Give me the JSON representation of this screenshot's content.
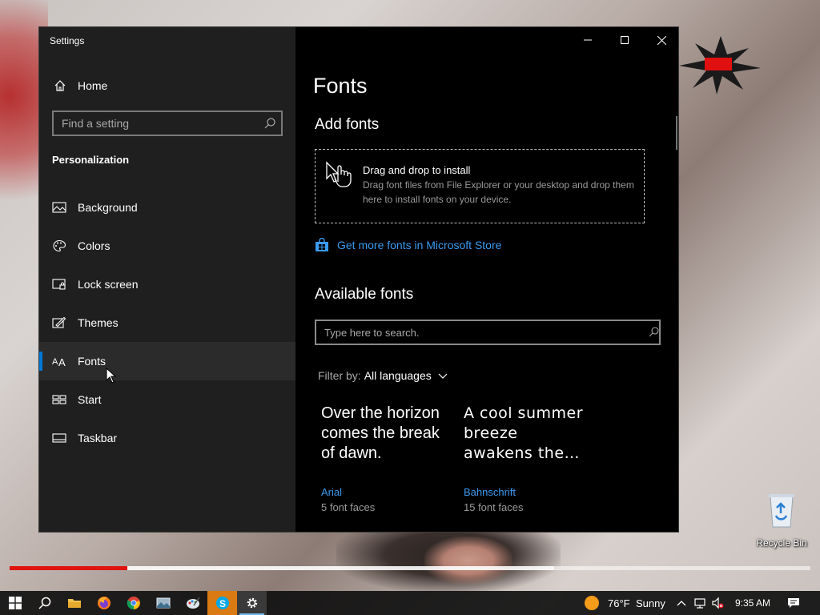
{
  "window": {
    "title": "Settings"
  },
  "sidebar": {
    "home_label": "Home",
    "search_placeholder": "Find a setting",
    "section_title": "Personalization",
    "items": [
      {
        "label": "Background",
        "icon": "picture-icon"
      },
      {
        "label": "Colors",
        "icon": "palette-icon"
      },
      {
        "label": "Lock screen",
        "icon": "lock-screen-icon"
      },
      {
        "label": "Themes",
        "icon": "themes-icon"
      },
      {
        "label": "Fonts",
        "icon": "fonts-icon",
        "selected": true
      },
      {
        "label": "Start",
        "icon": "start-icon"
      },
      {
        "label": "Taskbar",
        "icon": "taskbar-icon"
      }
    ]
  },
  "main": {
    "title": "Fonts",
    "add_fonts_heading": "Add fonts",
    "dropzone_title": "Drag and drop to install",
    "dropzone_desc": "Drag font files from File Explorer or your desktop and drop them here to install fonts on your device.",
    "store_link": "Get more fonts in Microsoft Store",
    "available_heading": "Available fonts",
    "search_placeholder": "Type here to search.",
    "filter_label": "Filter by:",
    "filter_value": "All languages",
    "fonts": [
      {
        "sample": "Over the horizon comes the break of dawn.",
        "name": "Arial",
        "faces": "5 font faces"
      },
      {
        "sample": "A cool summer breeze awakens the…",
        "name": "Bahnschrift",
        "faces": "15 font faces"
      }
    ]
  },
  "desktop": {
    "recycle_bin_label": "Recycle Bin",
    "video_progress": 0.147,
    "video_buffered": 0.68
  },
  "taskbar": {
    "weather_temp": "76°F",
    "weather_desc": "Sunny",
    "time": "9:35 AM",
    "apps": [
      "start-icon",
      "search-icon",
      "file-explorer-icon",
      "firefox-icon",
      "chrome-icon",
      "photos-icon",
      "paint-icon",
      "skype-icon",
      "settings-gear-icon"
    ]
  },
  "colors": {
    "accent": "#0078d7",
    "link": "#3a9bf0",
    "sidebar_bg": "#1f1f1f",
    "content_bg": "#000000"
  }
}
